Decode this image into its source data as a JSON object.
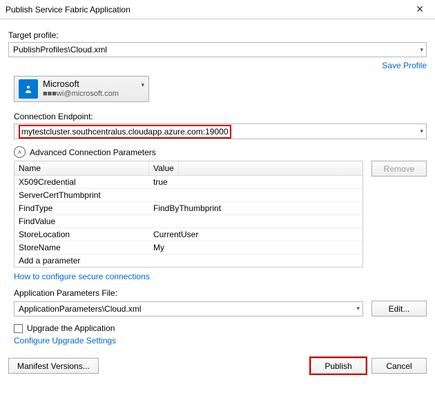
{
  "window": {
    "title": "Publish Service Fabric Application"
  },
  "targetProfile": {
    "label": "Target profile:",
    "value": "PublishProfiles\\Cloud.xml"
  },
  "saveProfile": "Save Profile",
  "account": {
    "name": "Microsoft",
    "email_masked": "■■■wi@microsoft.com"
  },
  "endpoint": {
    "label": "Connection Endpoint:",
    "value": "mytestcluster.southcentralus.cloudapp.azure.com:19000"
  },
  "advanced": {
    "title": "Advanced Connection Parameters",
    "columns": {
      "name": "Name",
      "value": "Value"
    },
    "rows": [
      {
        "name": "X509Credential",
        "value": "true"
      },
      {
        "name": "ServerCertThumbprint",
        "value": ""
      },
      {
        "name": "FindType",
        "value": "FindByThumbprint"
      },
      {
        "name": "FindValue",
        "value": ""
      },
      {
        "name": "StoreLocation",
        "value": "CurrentUser"
      },
      {
        "name": "StoreName",
        "value": "My"
      },
      {
        "name": "Add a parameter",
        "value": ""
      }
    ],
    "removeLabel": "Remove"
  },
  "secureLink": "How to configure secure connections",
  "appParams": {
    "label": "Application Parameters File:",
    "value": "ApplicationParameters\\Cloud.xml",
    "editLabel": "Edit..."
  },
  "upgrade": {
    "checkboxLabel": "Upgrade the Application",
    "configureLink": "Configure Upgrade Settings"
  },
  "footer": {
    "manifest": "Manifest Versions...",
    "publish": "Publish",
    "cancel": "Cancel"
  }
}
